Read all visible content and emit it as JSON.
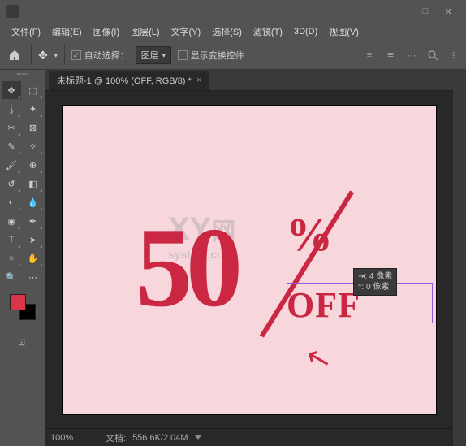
{
  "menu": {
    "items": [
      "文件(F)",
      "编辑(E)",
      "图像(I)",
      "图层(L)",
      "文字(Y)",
      "选择(S)",
      "滤镜(T)",
      "3D(D)",
      "视图(V)"
    ]
  },
  "options": {
    "auto_select_label": "自动选择：",
    "dropdown_value": "图层",
    "show_transform_label": "显示变换控件"
  },
  "tab": {
    "title": "未标题-1 @ 100% (OFF, RGB/8) *"
  },
  "canvas": {
    "text_50": "50",
    "text_pct": "%",
    "text_off": "OFF",
    "watermark_main": "XY",
    "watermark_sub": "system.com",
    "watermark_cn": "网"
  },
  "tooltip": {
    "line1": "⇥: 4 像素",
    "line2": "⤒: 0 像素"
  },
  "status": {
    "zoom": "100%",
    "doc_label": "文档:",
    "doc_value": "556.6K/2.04M"
  },
  "swatch": {
    "fg": "#d83648"
  }
}
